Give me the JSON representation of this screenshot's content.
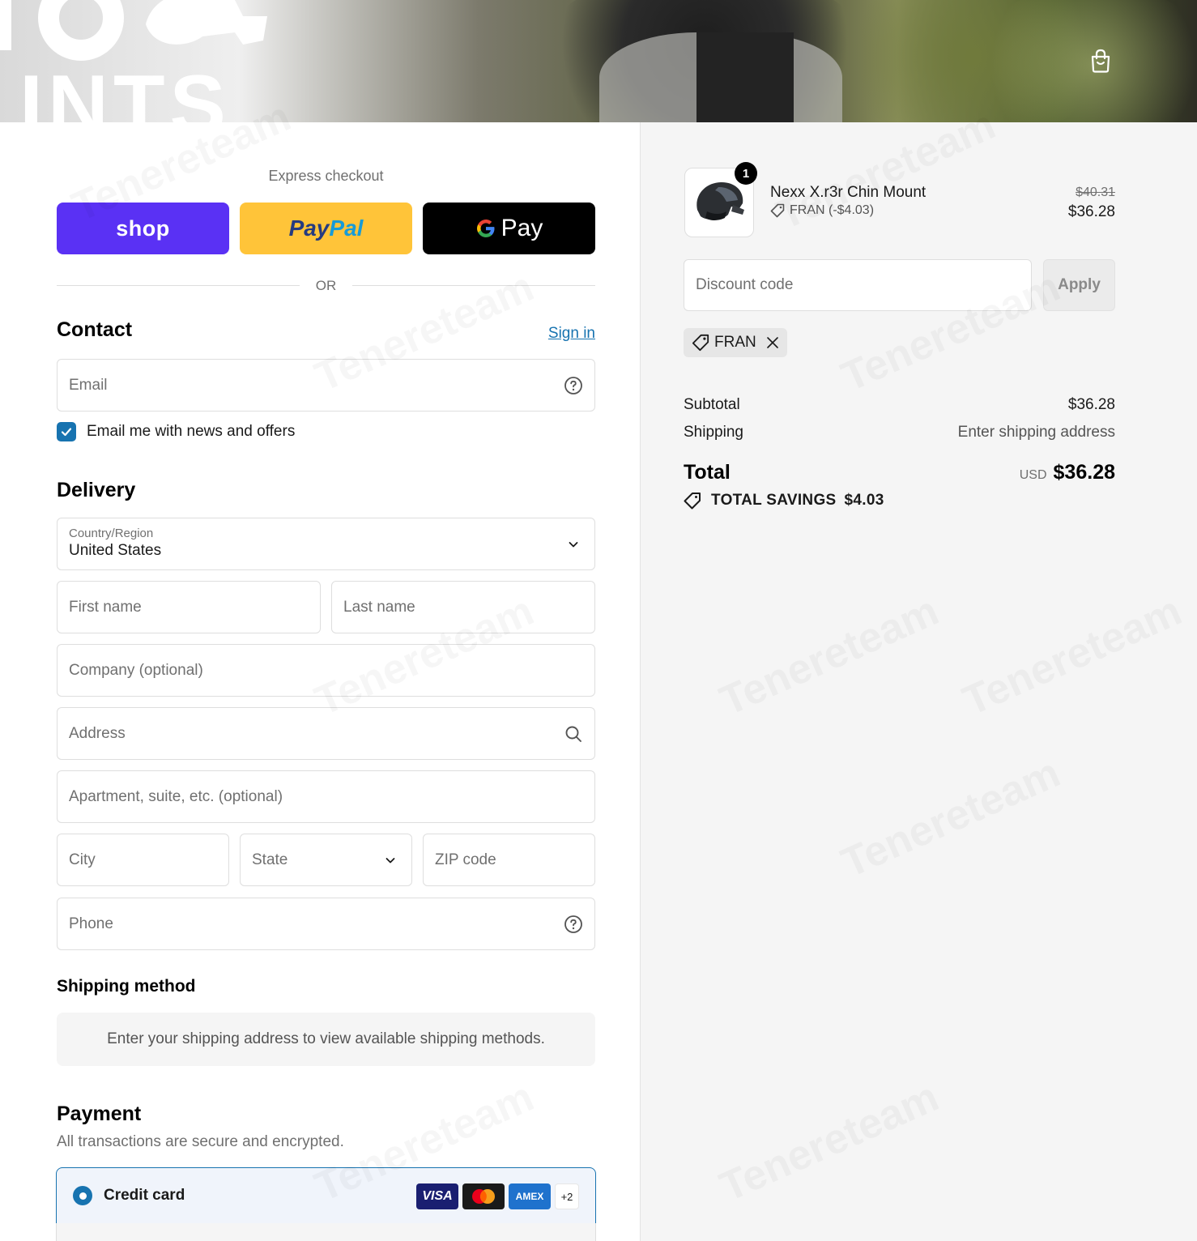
{
  "header": {
    "logo_text": "INTS",
    "cart_icon": "shopping-bag-icon"
  },
  "express": {
    "label": "Express checkout",
    "shop_label": "shop",
    "paypal_label_1": "Pay",
    "paypal_label_2": "Pal",
    "gpay_label": "Pay",
    "or_label": "OR"
  },
  "contact": {
    "title": "Contact",
    "sign_in": "Sign in",
    "email_placeholder": "Email",
    "newsletter_label": "Email me with news and offers",
    "newsletter_checked": true
  },
  "delivery": {
    "title": "Delivery",
    "country_label": "Country/Region",
    "country_value": "United States",
    "first_name": "First name",
    "last_name": "Last name",
    "company": "Company (optional)",
    "address": "Address",
    "apartment": "Apartment, suite, etc. (optional)",
    "city": "City",
    "state": "State",
    "zip": "ZIP code",
    "phone": "Phone"
  },
  "shipping": {
    "title": "Shipping method",
    "note": "Enter your shipping address to view available shipping methods."
  },
  "payment": {
    "title": "Payment",
    "subtitle": "All transactions are secure and encrypted.",
    "method_label": "Credit card",
    "cards": [
      "VISA",
      "mastercard",
      "AMEX"
    ],
    "more_cards": "+2"
  },
  "summary": {
    "product": {
      "name": "Nexx X.r3r Chin Mount",
      "quantity": "1",
      "discount_label": "FRAN (-$4.03)",
      "price_original": "$40.31",
      "price_final": "$36.28"
    },
    "discount_placeholder": "Discount code",
    "apply_label": "Apply",
    "applied_code": "FRAN",
    "subtotal_label": "Subtotal",
    "subtotal_value": "$36.28",
    "shipping_label": "Shipping",
    "shipping_value": "Enter shipping address",
    "total_label": "Total",
    "currency": "USD",
    "total_value": "$36.28",
    "savings_label": "TOTAL SAVINGS",
    "savings_value": "$4.03"
  },
  "colors": {
    "shop": "#5a31f4",
    "paypal": "#ffc439",
    "gpay": "#000000",
    "accent": "#1773b0"
  },
  "watermark": "Tenereteam"
}
